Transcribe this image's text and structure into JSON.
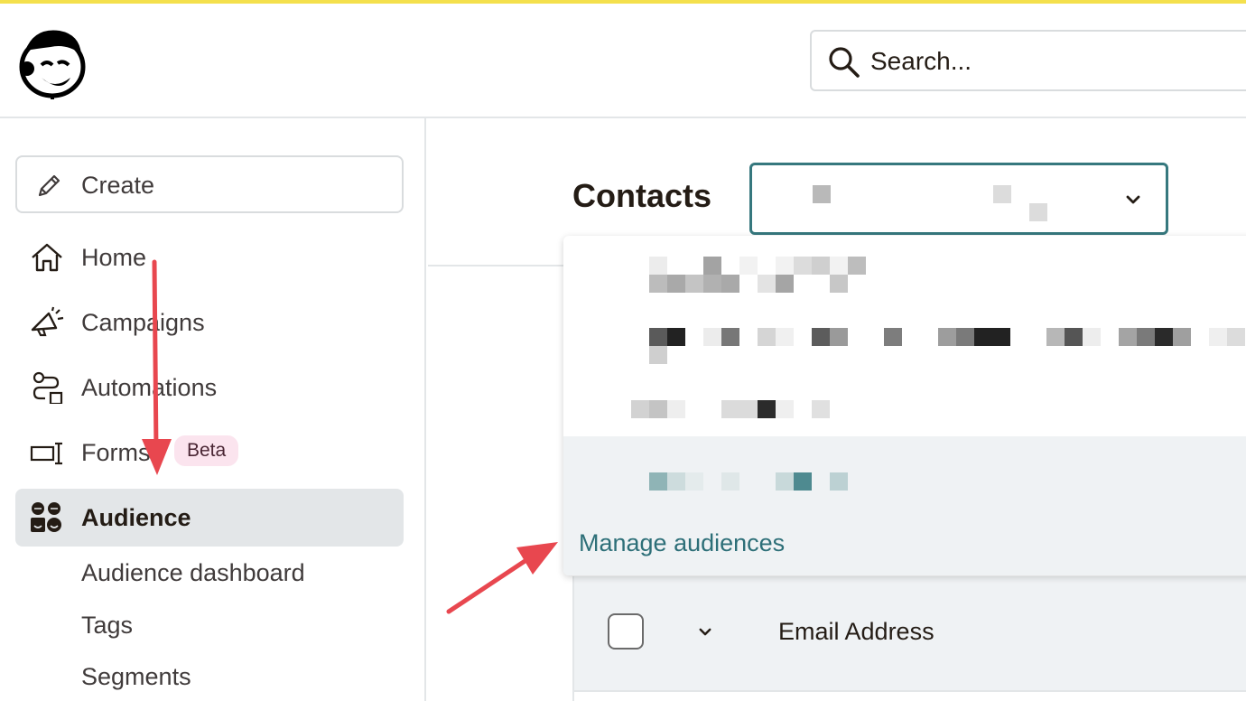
{
  "header": {
    "logo_name": "mailchimp-logo",
    "search": {
      "placeholder": "Search..."
    }
  },
  "sidebar": {
    "create_label": "Create",
    "items": [
      {
        "id": "home",
        "label": "Home",
        "icon": "home-icon"
      },
      {
        "id": "campaigns",
        "label": "Campaigns",
        "icon": "megaphone-icon"
      },
      {
        "id": "automations",
        "label": "Automations",
        "icon": "automation-icon"
      },
      {
        "id": "forms",
        "label": "Forms",
        "icon": "form-icon",
        "badge": "Beta"
      },
      {
        "id": "audience",
        "label": "Audience",
        "icon": "audience-icon",
        "active": true
      }
    ],
    "sub_items": [
      "Audience dashboard",
      "Tags",
      "Segments"
    ]
  },
  "main": {
    "title": "Contacts",
    "audience_select": {
      "value": ""
    },
    "dropdown": {
      "options": [
        "",
        "",
        "",
        ""
      ],
      "selected_index": 3,
      "manage_link": "Manage audiences"
    },
    "table": {
      "columns": [
        "Email Address"
      ]
    }
  },
  "colors": {
    "accent": "#f4e04d",
    "focus_border": "#36787e",
    "link": "#2d6f78",
    "beta_badge_bg": "#fbe4ee",
    "arrow": "#e8474f"
  }
}
